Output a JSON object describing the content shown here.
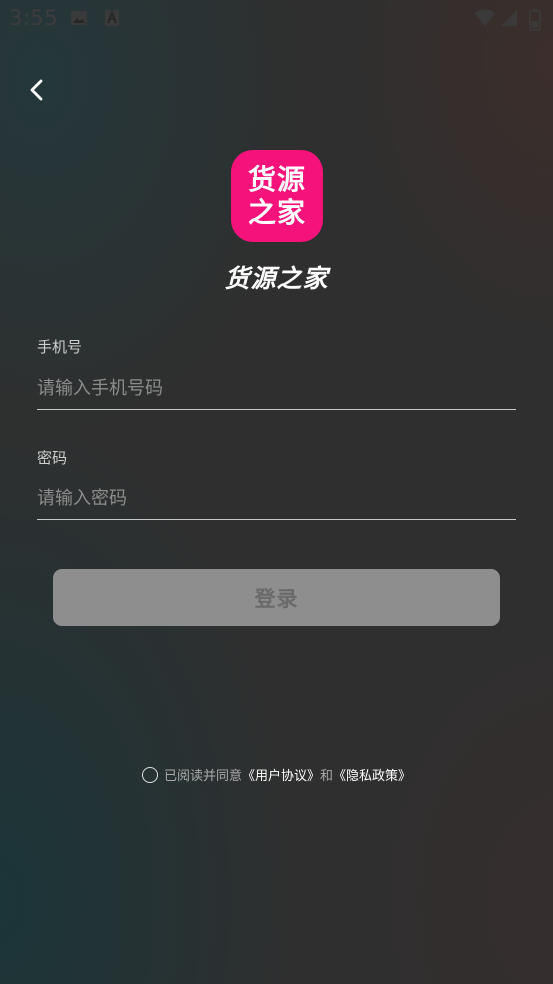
{
  "status_bar": {
    "time": "3:55",
    "icons": [
      "image-icon",
      "font-icon",
      "wifi-icon",
      "signal-icon",
      "battery-icon"
    ]
  },
  "header": {
    "back_icon": "chevron-left-icon"
  },
  "app": {
    "logo_line1": "货源",
    "logo_line2": "之家",
    "logo_color": "#f5127a",
    "name": "货源之家"
  },
  "form": {
    "phone_label": "手机号",
    "phone_placeholder": "请输入手机号码",
    "phone_value": "",
    "password_label": "密码",
    "password_placeholder": "请输入密码",
    "password_value": "",
    "login_label": "登录"
  },
  "agreement": {
    "prefix": "已阅读并同意",
    "user_agreement": "《用户协议》",
    "and": "和",
    "privacy_policy": "《隐私政策》",
    "checked": false
  }
}
